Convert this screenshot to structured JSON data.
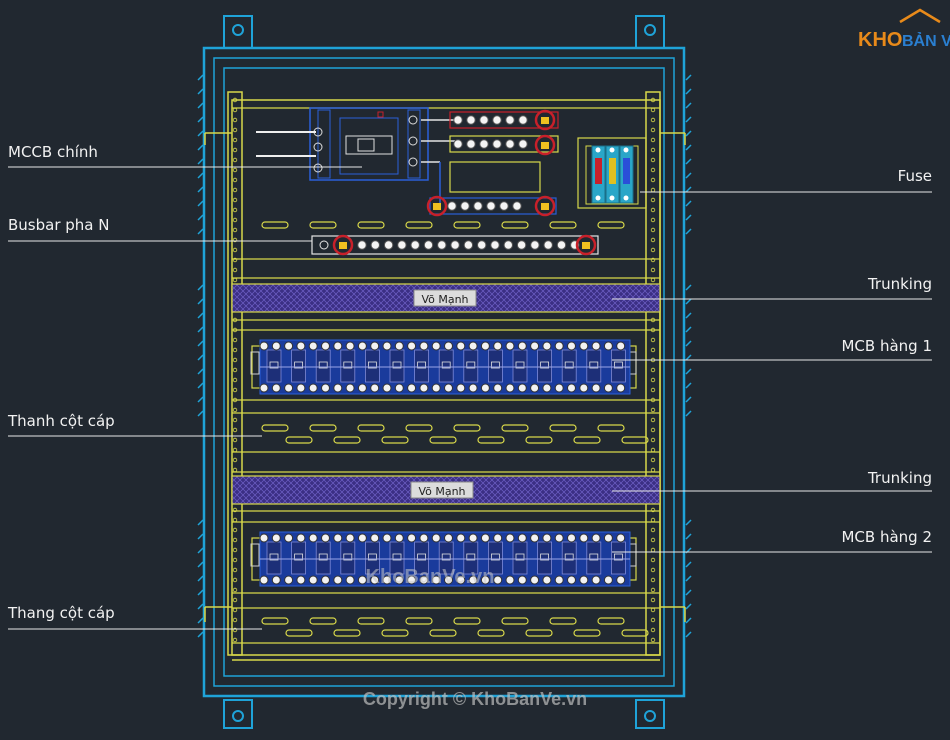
{
  "labels": {
    "mccb_main": "MCCB  chính",
    "busbar_n": "Busbar pha N",
    "thanh_cot_cap": "Thanh cột cáp",
    "thang_cot_cap": "Thang cột cáp",
    "fuse": "Fuse",
    "trunking_1": "Trunking",
    "mcb_row_1": "MCB hàng 1",
    "trunking_2": "Trunking",
    "mcb_row_2": "MCB hàng 2"
  },
  "trunking_text": {
    "top": "Võ Mạnh",
    "bottom": "Võ Mạnh"
  },
  "logo": {
    "text_orange": "KHO",
    "text_blue": "BẢN VẼ"
  },
  "watermarks": {
    "center": "KhoBanVe.vn",
    "copyright": "Copyright © KhoBanVe.vn"
  },
  "colors": {
    "background": "#212830",
    "enclosure": "#1fa3d8",
    "frame_yellow": "#d8d84a",
    "trunking_fill": "#3c2f86",
    "busbar_bolt": "#c8202a",
    "breaker_blue": "#1a3b9c",
    "label_text": "#f2f2f2"
  }
}
